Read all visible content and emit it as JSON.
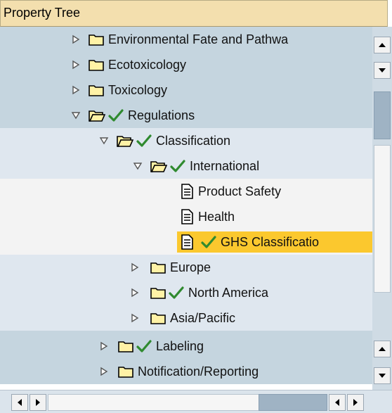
{
  "header": {
    "title": "Property Tree"
  },
  "tree": {
    "rows": [
      {
        "label": "Environmental Fate and Pathwa",
        "checked": false,
        "expanded": false,
        "icon": "folder-icon"
      },
      {
        "label": "Ecotoxicology",
        "checked": false,
        "expanded": false,
        "icon": "folder-icon"
      },
      {
        "label": "Toxicology",
        "checked": false,
        "expanded": false,
        "icon": "folder-icon"
      },
      {
        "label": "Regulations",
        "checked": true,
        "expanded": true,
        "icon": "folder-open-icon"
      },
      {
        "label": "Classification",
        "checked": true,
        "expanded": true,
        "icon": "folder-open-icon"
      },
      {
        "label": "International",
        "checked": true,
        "expanded": true,
        "icon": "folder-open-icon"
      },
      {
        "label": "Product Safety",
        "checked": false,
        "icon": "document-icon"
      },
      {
        "label": "Health",
        "checked": false,
        "icon": "document-icon"
      },
      {
        "label": "GHS Classificatio",
        "checked": true,
        "selected": true,
        "icon": "document-icon"
      },
      {
        "label": "Europe",
        "checked": false,
        "expanded": false,
        "icon": "folder-icon"
      },
      {
        "label": "North America",
        "checked": true,
        "expanded": false,
        "icon": "folder-icon"
      },
      {
        "label": "Asia/Pacific",
        "checked": false,
        "expanded": false,
        "icon": "folder-icon"
      },
      {
        "label": "Labeling",
        "checked": true,
        "expanded": false,
        "icon": "folder-icon"
      },
      {
        "label": "Notification/Reporting",
        "checked": false,
        "expanded": false,
        "icon": "folder-icon"
      }
    ]
  },
  "colors": {
    "header_bg": "#f3dfae",
    "row_blue": "#c5d5df",
    "row_light": "#dfe7ef",
    "selected": "#fbc82e",
    "check": "#2f8a2f"
  }
}
